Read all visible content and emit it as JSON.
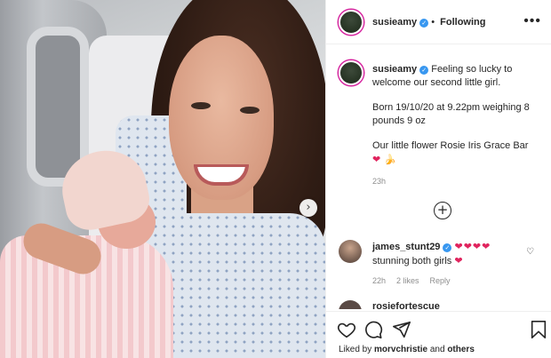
{
  "header": {
    "username": "susieamy",
    "follow_status": "Following",
    "separator": "•",
    "more": "•••"
  },
  "caption": {
    "username": "susieamy",
    "line1": "Feeling so lucky to welcome our second little girl.",
    "line2": "Born 19/10/20 at 9.22pm weighing 8 pounds 9 oz",
    "line3": "Our little flower Rosie Iris Grace Bar",
    "emoji_hearts": "❤",
    "emoji_banana": "🍌",
    "time": "23h"
  },
  "load_more": "+",
  "comments": [
    {
      "username": "james_stunt29",
      "hearts": "❤❤❤❤",
      "text": "stunning both girls",
      "text_heart": "❤",
      "time": "22h",
      "likes": "2 likes",
      "reply": "Reply"
    },
    {
      "username": "rosiefortescue"
    }
  ],
  "likes": {
    "prefix": "Liked by",
    "user": "morvchristie",
    "and": "and",
    "others": "others"
  },
  "photo": {
    "next_arrow": "›"
  },
  "colors": {
    "verified": "#3897f0",
    "heart": "#e0245e",
    "border": "#efefef",
    "muted": "#8e8e8e"
  },
  "icons": [
    "heart-icon",
    "comment-icon",
    "share-icon",
    "bookmark-icon",
    "verified-icon",
    "more-icon"
  ]
}
